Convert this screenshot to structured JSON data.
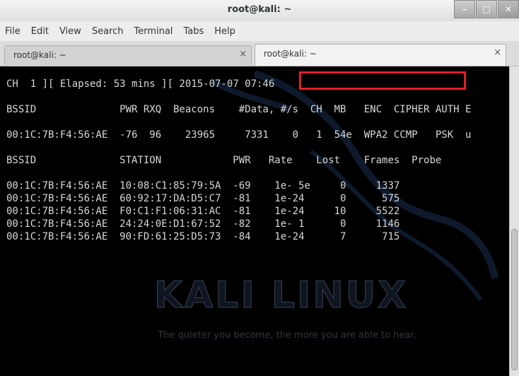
{
  "window": {
    "title": "root@kali: ~"
  },
  "menu": [
    "File",
    "Edit",
    "View",
    "Search",
    "Terminal",
    "Tabs",
    "Help"
  ],
  "tabs": [
    {
      "label": "root@kali: ~",
      "close": "×"
    },
    {
      "label": "root@kali: ~",
      "close": "×"
    }
  ],
  "terminal": {
    "lines": [
      "CH  1 ][ Elapsed: 53 mins ][ 2015-07-07 07:46",
      "",
      "BSSID              PWR RXQ  Beacons    #Data, #/s  CH  MB   ENC  CIPHER AUTH E",
      "",
      "00:1C:7B:F4:56:AE  -76  96    23965     7331    0   1  54e  WPA2 CCMP   PSK  u",
      "",
      "BSSID              STATION            PWR   Rate    Lost    Frames  Probe",
      "",
      "00:1C:7B:F4:56:AE  10:08:C1:85:79:5A  -69    1e- 5e     0     1337",
      "00:1C:7B:F4:56:AE  60:92:17:DA:D5:C7  -81    1e-24      0      575",
      "00:1C:7B:F4:56:AE  F0:C1:F1:06:31:AC  -81    1e-24     10     5522",
      "00:1C:7B:F4:56:AE  24:24:0E:D1:67:52  -82    1e- 1      0     1146",
      "00:1C:7B:F4:56:AE  90:FD:61:25:D5:73  -84    1e-24      7      715"
    ]
  },
  "watermark": {
    "logo": "KALI LINUX",
    "tagline": "The quieter you become, the more you are able to hear."
  },
  "colors": {
    "highlight": "#e0202a",
    "terminal_bg": "#000000"
  }
}
